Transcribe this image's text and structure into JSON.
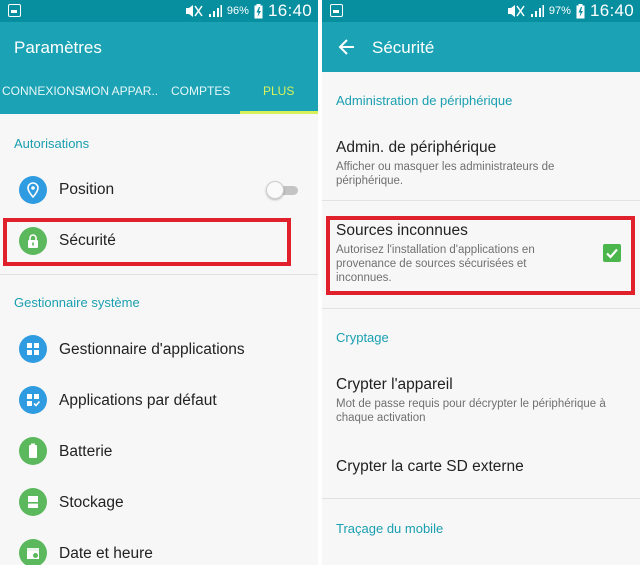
{
  "left": {
    "status_bar": {
      "battery_pct": "96%",
      "time": "16:40"
    },
    "app_bar": {
      "title": "Paramètres"
    },
    "tabs": [
      {
        "label": "CONNEXIONS"
      },
      {
        "label": "MON APPAR.."
      },
      {
        "label": "COMPTES"
      },
      {
        "label": "PLUS",
        "active": true
      }
    ],
    "sections": [
      {
        "header": "Autorisations",
        "items": [
          {
            "label": "Position",
            "icon": "location-pin-icon",
            "color": "#2f9be0",
            "toggle": "off"
          },
          {
            "label": "Sécurité",
            "icon": "lock-icon",
            "color": "#5cb85c"
          }
        ]
      },
      {
        "header": "Gestionnaire système",
        "items": [
          {
            "label": "Gestionnaire d'applications",
            "icon": "app-grid-icon",
            "color": "#2f9be0"
          },
          {
            "label": "Applications par défaut",
            "icon": "default-apps-icon",
            "color": "#2f9be0"
          },
          {
            "label": "Batterie",
            "icon": "battery-icon",
            "color": "#5cb85c"
          },
          {
            "label": "Stockage",
            "icon": "storage-icon",
            "color": "#5cb85c"
          },
          {
            "label": "Date et heure",
            "icon": "calendar-icon",
            "color": "#5cb85c"
          }
        ]
      }
    ]
  },
  "right": {
    "status_bar": {
      "battery_pct": "97%",
      "time": "16:40"
    },
    "app_bar": {
      "title": "Sécurité"
    },
    "sections": [
      {
        "header": "Administration de périphérique",
        "items": [
          {
            "title": "Admin. de périphérique",
            "desc": "Afficher ou masquer les administrateurs de périphérique."
          },
          {
            "title": "Sources inconnues",
            "desc": "Autorisez l'installation d'applications en provenance de sources sécurisées et inconnues.",
            "checked": true
          }
        ]
      },
      {
        "header": "Cryptage",
        "items": [
          {
            "title": "Crypter l'appareil",
            "desc": "Mot de passe requis pour décrypter le périphérique à chaque activation"
          },
          {
            "title": "Crypter la carte SD externe"
          }
        ]
      },
      {
        "header": "Traçage du mobile"
      }
    ]
  },
  "colors": {
    "status_bar": "#078fa0",
    "app_bar": "#1ba3b5",
    "accent": "#1a9fb0",
    "active_tab": "#d8f05c",
    "highlight": "#e0202a",
    "check": "#4bb64b"
  }
}
